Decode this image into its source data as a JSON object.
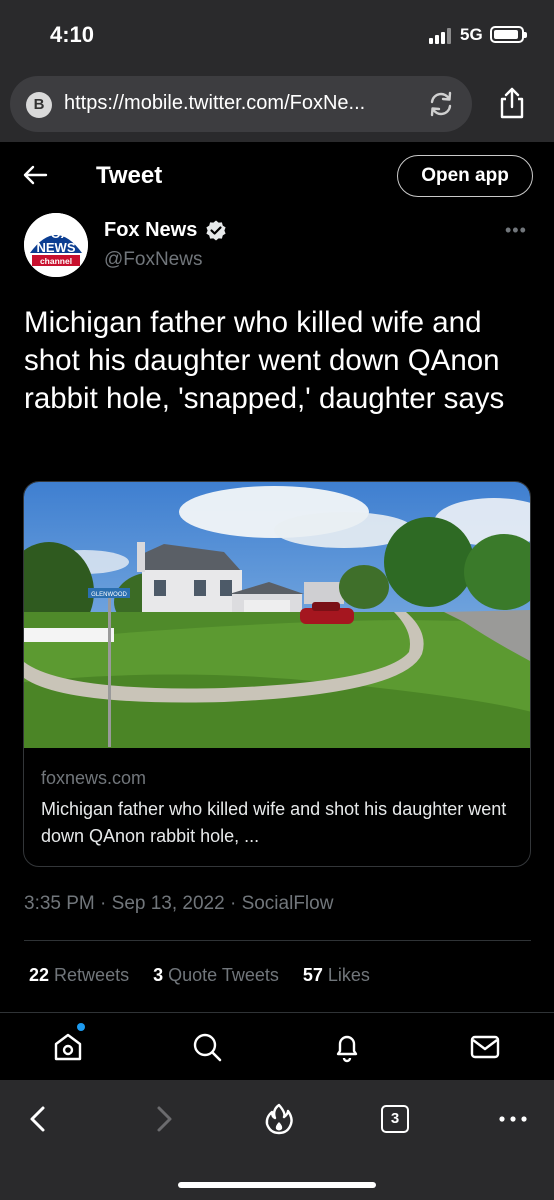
{
  "status_bar": {
    "time": "4:10",
    "network": "5G"
  },
  "browser": {
    "badge": "B",
    "url": "https://mobile.twitter.com/FoxNe..."
  },
  "header": {
    "title": "Tweet",
    "open_app_label": "Open app"
  },
  "author": {
    "name": "Fox News",
    "handle": "@FoxNews",
    "avatar_text_1": "FOX",
    "avatar_text_2": "NEWS",
    "avatar_text_3": "channel"
  },
  "tweet": {
    "text": "Michigan father who killed wife and shot his daughter went down QAnon rabbit hole, 'snapped,' daughter says",
    "meta": "3:35 PM · Sep 13, 2022 · SocialFlow"
  },
  "card": {
    "sign_text": "GLENWOOD",
    "domain": "foxnews.com",
    "title": "Michigan father who killed wife and shot his daughter went down QAnon rabbit hole, ..."
  },
  "stats": {
    "retweets_count": "22",
    "retweets_label": "Retweets",
    "quotes_count": "3",
    "quotes_label": "Quote Tweets",
    "likes_count": "57",
    "likes_label": "Likes"
  },
  "tab_count": "3",
  "colors": {
    "accent": "#1d9bf0",
    "background": "#000000",
    "chrome": "#2a2a2c",
    "muted": "#71767b"
  },
  "icons": [
    "back-arrow-icon",
    "verified-icon",
    "more-icon",
    "reload-icon",
    "share-icon",
    "home-icon",
    "search-icon",
    "bell-icon",
    "mail-icon",
    "chevron-left-icon",
    "chevron-right-icon",
    "flame-icon",
    "tabs-icon",
    "ellipsis-icon"
  ]
}
